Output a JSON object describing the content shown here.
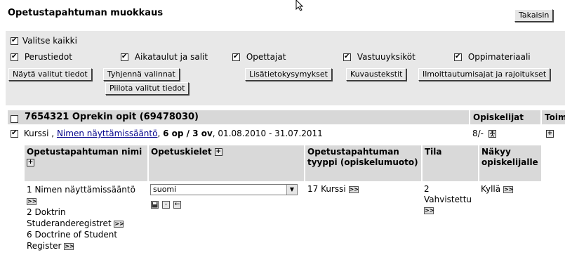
{
  "page": {
    "title": "Opetustapahtuman muokkaus",
    "back_button": "Takaisin"
  },
  "filters": {
    "select_all": "Valitse kaikki",
    "options": [
      {
        "label": "Perustiedot",
        "checked": true
      },
      {
        "label": "Aikataulut ja salit",
        "checked": true
      },
      {
        "label": "Opettajat",
        "checked": true
      },
      {
        "label": "Vastuuyksiköt",
        "checked": true
      },
      {
        "label": "Oppimateriaali",
        "checked": true
      }
    ],
    "buttons": {
      "show_selected": "Näytä valitut tiedot",
      "clear_selections": "Tyhjennä valinnat",
      "hide_selected": "Piilota valitut tiedot",
      "extra_questions": "Lisätietokysymykset",
      "description_texts": "Kuvaustekstit",
      "enrollment_times": "Ilmoittautumisajat ja rajoitukset"
    }
  },
  "course": {
    "header_title": "7654321 Oprekin opit (69478030)",
    "col_students": "Opiskelijat",
    "col_actions": "Toim",
    "row": {
      "type": "Kurssi ,",
      "link": "Nimen näyttämissääntö",
      "credits": "6 op / 3 ov",
      "dates": ", 01.08.2010 - 31.07.2011",
      "students": "8/-"
    }
  },
  "details": {
    "headers": {
      "name": "Opetustapahtuman nimi",
      "languages": "Opetuskielet",
      "event_type": "Opetustapahtuman tyyppi (opiskelumuoto)",
      "status": "Tila",
      "visible": "Näkyy opiskelijalle"
    },
    "names": [
      "1 Nimen näyttämissääntö",
      "2 Doktrin Studeranderegistret",
      "6 Doctrine of Student Register"
    ],
    "language_selected": "suomi",
    "event_type_value": "17 Kurssi",
    "status_code": "2",
    "status_label": "Vahvistettu",
    "visible_value": "Kyllä"
  },
  "icons": {
    "expand": ">>",
    "plus": "+",
    "minus": "-",
    "arrow_left": "←",
    "save": "■"
  }
}
